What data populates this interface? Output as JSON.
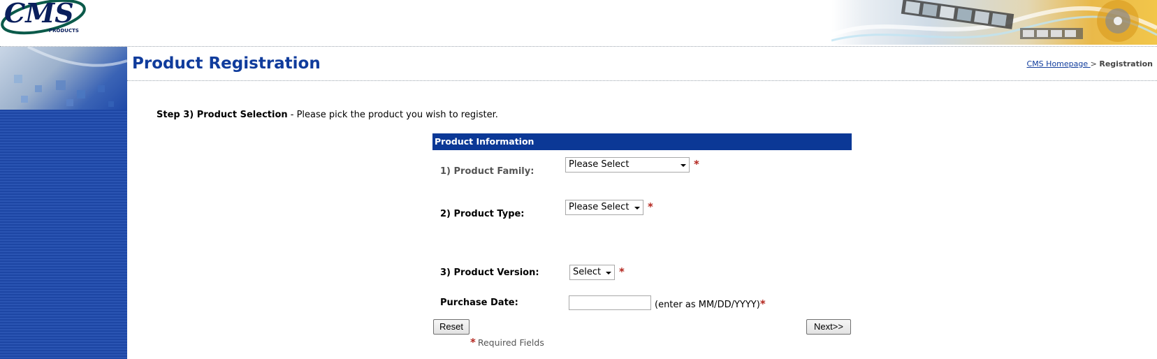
{
  "header": {
    "logo_text": "CMS",
    "logo_sub": "PRODUCTS"
  },
  "page": {
    "title": "Product Registration",
    "breadcrumb": {
      "home_link": "CMS Homepage ",
      "separator": ">",
      "current": "Registration"
    },
    "step": {
      "label": "Step 3) Product Selection",
      "description": " - Please pick the product you wish to register."
    }
  },
  "form": {
    "section_header": "Product Information",
    "required_mark": "*",
    "fields": {
      "product_family": {
        "label": "1) Product Family:",
        "selected": "Please Select"
      },
      "product_type": {
        "label": "2) Product Type:",
        "selected": "Please Select"
      },
      "product_version": {
        "label": "3) Product Version:",
        "selected": "Select"
      },
      "purchase_date": {
        "label": "Purchase Date:",
        "value": "",
        "hint": "(enter as MM/DD/YYYY)"
      }
    },
    "buttons": {
      "reset": "Reset",
      "next": "Next>>"
    },
    "required_note": "Required Fields"
  },
  "colors": {
    "brand_blue": "#103c9c",
    "header_bar": "#0b3896",
    "sidebar": "#1f49a8",
    "required": "#b3261e"
  },
  "icons": [
    "cms-logo",
    "banner-film-strip",
    "dropdown-arrow-icon",
    "required-asterisk"
  ]
}
